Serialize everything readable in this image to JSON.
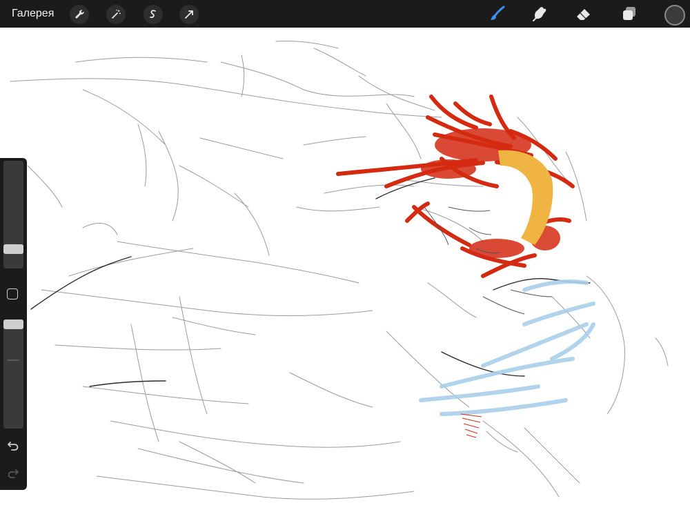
{
  "app": {
    "gallery_label": "Галерея",
    "toolbar_left": [
      "wrench-icon",
      "magic-wand-icon",
      "selection-icon",
      "transform-arrow-icon"
    ],
    "toolbar_right": [
      "brush-icon",
      "smudge-icon",
      "eraser-icon",
      "layers-icon",
      "color-swatch"
    ]
  },
  "colors": {
    "toolbar_bg": "#1b1b1b",
    "active_tool": "#3b8ff5",
    "current_color": "#3b3b3b",
    "sketch_red": "#d42a12",
    "sketch_yellow": "#f0b443",
    "sketch_blue": "#a9d0ea",
    "sketch_line": "#8a8a8a"
  },
  "sidebar": {
    "brush_size_level": 0.15,
    "opacity_level": 1.0,
    "icons": [
      "modify-square-icon",
      "undo-icon",
      "redo-icon"
    ]
  }
}
